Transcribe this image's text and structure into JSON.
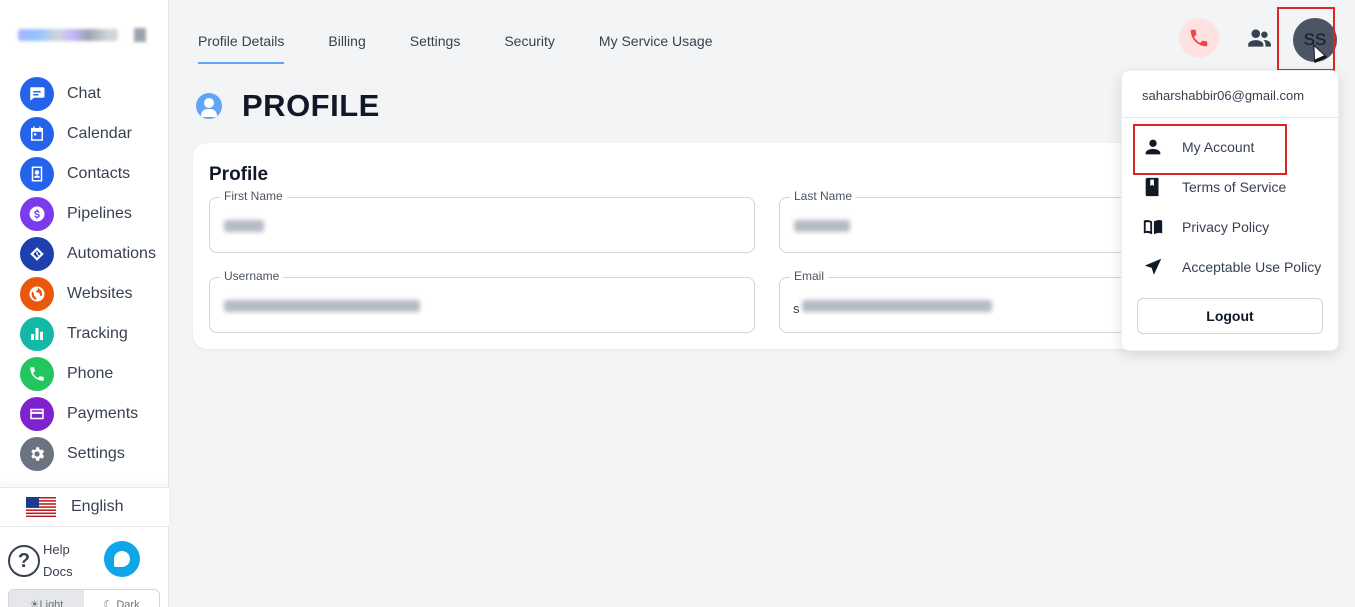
{
  "sidebar": {
    "items": [
      {
        "label": "Chat",
        "icon": "chat-icon",
        "color": "#2563eb"
      },
      {
        "label": "Calendar",
        "icon": "calendar-icon",
        "color": "#2563eb"
      },
      {
        "label": "Contacts",
        "icon": "contacts-icon",
        "color": "#2563eb"
      },
      {
        "label": "Pipelines",
        "icon": "dollar-icon",
        "color": "#7c3aed"
      },
      {
        "label": "Automations",
        "icon": "automation-icon",
        "color": "#1e40af"
      },
      {
        "label": "Websites",
        "icon": "globe-icon",
        "color": "#ea580c"
      },
      {
        "label": "Tracking",
        "icon": "chart-icon",
        "color": "#14b8a6"
      },
      {
        "label": "Phone",
        "icon": "phone-icon",
        "color": "#22c55e"
      },
      {
        "label": "Payments",
        "icon": "card-icon",
        "color": "#7e22ce"
      },
      {
        "label": "Settings",
        "icon": "gear-icon",
        "color": "#6b7280"
      }
    ],
    "language": "English",
    "help_line1": "Help",
    "help_line2": "Docs",
    "theme_light": "☀Light",
    "theme_dark": "☾ Dark"
  },
  "tabs": [
    {
      "label": "Profile Details",
      "active": true
    },
    {
      "label": "Billing",
      "active": false
    },
    {
      "label": "Settings",
      "active": false
    },
    {
      "label": "Security",
      "active": false
    },
    {
      "label": "My Service Usage",
      "active": false
    }
  ],
  "avatar_initials": "SS",
  "page_title": "PROFILE",
  "profile": {
    "card_title": "Profile",
    "first_name_label": "First Name",
    "last_name_label": "Last Name",
    "username_label": "Username",
    "email_label": "Email",
    "email_visible_prefix": "s"
  },
  "dropdown": {
    "email": "saharshabbir06@gmail.com",
    "items": [
      {
        "label": "My Account",
        "icon": "person-icon"
      },
      {
        "label": "Terms of Service",
        "icon": "book-icon"
      },
      {
        "label": "Privacy Policy",
        "icon": "open-book-icon"
      },
      {
        "label": "Acceptable Use Policy",
        "icon": "navigation-arrow-icon"
      }
    ],
    "logout": "Logout"
  }
}
